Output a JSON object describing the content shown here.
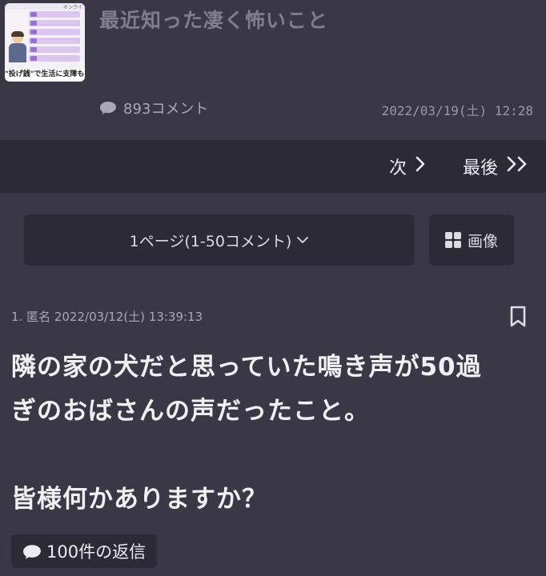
{
  "topic": {
    "title": "最近知った凄く怖いこと",
    "comment_count": "893コメント",
    "date": "2022/03/19(土) 12:28",
    "thumbnail_caption": "\"投げ銭\"で生活に支障も",
    "thumbnail_header": "オンライ"
  },
  "pager": {
    "next_label": "次",
    "last_label": "最後"
  },
  "controls": {
    "page_select_label": "1ページ(1-50コメント)",
    "image_button_label": "画像"
  },
  "post": {
    "meta": "1. 匿名 2022/03/12(土) 13:39:13",
    "lines": [
      "隣の家の犬だと思っていた鳴き声が50過",
      "ぎのおばさんの声だったこと。",
      "皆様何かありますか？"
    ],
    "reply_label": "100件の返信"
  },
  "colors": {
    "background": "#3a3845",
    "panel": "#2c2a34",
    "title_muted": "#7f7e89",
    "text": "#f1f1f4"
  },
  "icons": [
    "comment-bubble-icon",
    "chevron-right-icon",
    "double-chevron-right-icon",
    "chevron-down-icon",
    "grid-icon",
    "bookmark-icon"
  ]
}
